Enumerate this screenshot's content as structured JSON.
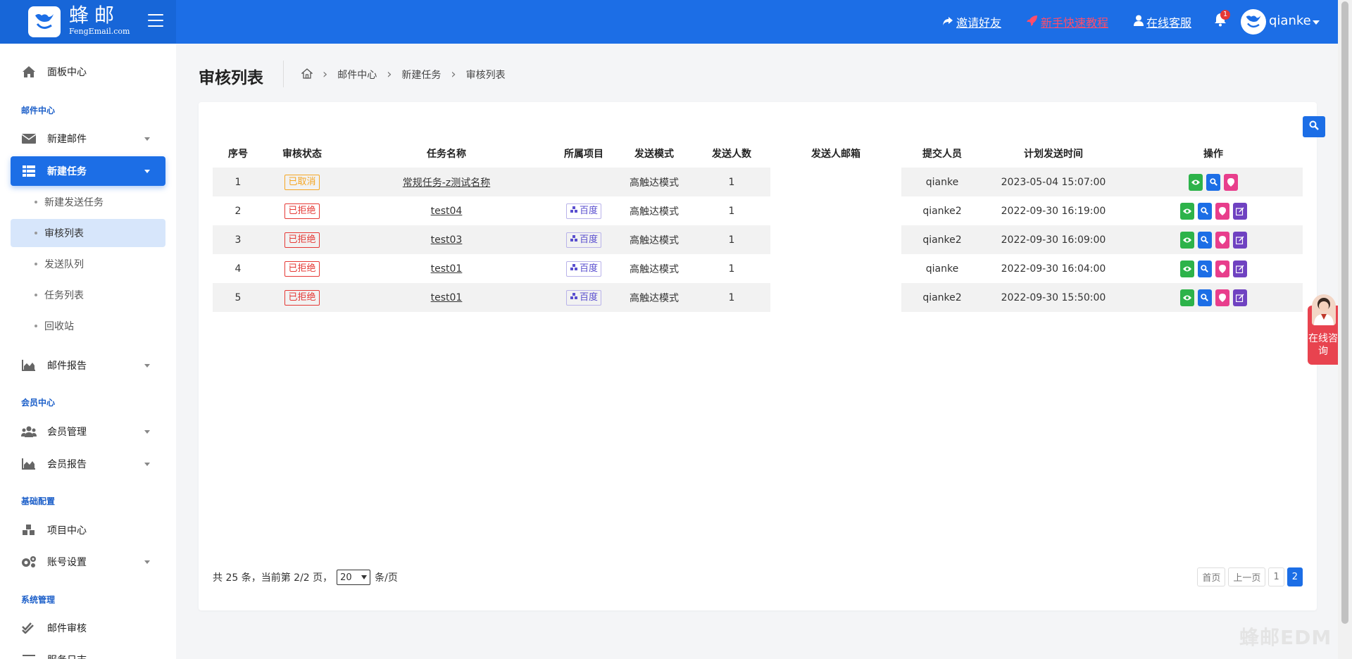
{
  "header": {
    "brand_name": "蜂邮",
    "brand_sub": "FengEmail.com",
    "links": {
      "invite": "邀请好友",
      "tutorial": "新手快速教程",
      "support": "在线客服"
    },
    "notification_count": "1",
    "username": "qianke",
    "colors": {
      "primary": "#1c6ee6",
      "tutorial": "#ff4d6b"
    }
  },
  "sidebar": {
    "dashboard": "面板中心",
    "section_mail": "邮件中心",
    "new_mail": "新建邮件",
    "new_task": "新建任务",
    "sub_items": [
      "新建发送任务",
      "审核列表",
      "发送队列",
      "任务列表",
      "回收站"
    ],
    "mail_report": "邮件报告",
    "section_member": "会员中心",
    "member_mgmt": "会员管理",
    "member_report": "会员报告",
    "section_config": "基础配置",
    "project_center": "项目中心",
    "account_settings": "账号设置",
    "section_system": "系统管理",
    "mail_review": "邮件审核",
    "more": "服务日志"
  },
  "page": {
    "title": "审核列表",
    "breadcrumb": [
      "邮件中心",
      "新建任务",
      "审核列表"
    ]
  },
  "table": {
    "columns": [
      "序号",
      "审核状态",
      "任务名称",
      "所属项目",
      "发送模式",
      "发送人数",
      "发送人邮箱",
      "提交人员",
      "计划发送时间",
      "操作"
    ],
    "rows": [
      {
        "no": "1",
        "status": "已取消",
        "status_type": "cancel",
        "name": "常规任务-z测试名称",
        "project": "",
        "mode": "高触达模式",
        "count": "1",
        "email": "",
        "submitter": "qianke",
        "time": "2023-05-04 15:07:00",
        "ops": [
          "eye",
          "mag",
          "pin"
        ]
      },
      {
        "no": "2",
        "status": "已拒绝",
        "status_type": "reject",
        "name": "test04",
        "project": "百度",
        "mode": "高触达模式",
        "count": "1",
        "email": "",
        "submitter": "qianke2",
        "time": "2022-09-30 16:19:00",
        "ops": [
          "eye",
          "mag",
          "pin",
          "edit"
        ]
      },
      {
        "no": "3",
        "status": "已拒绝",
        "status_type": "reject",
        "name": "test03",
        "project": "百度",
        "mode": "高触达模式",
        "count": "1",
        "email": "",
        "submitter": "qianke2",
        "time": "2022-09-30 16:09:00",
        "ops": [
          "eye",
          "mag",
          "pin",
          "edit"
        ]
      },
      {
        "no": "4",
        "status": "已拒绝",
        "status_type": "reject",
        "name": "test01",
        "project": "百度",
        "mode": "高触达模式",
        "count": "1",
        "email": "",
        "submitter": "qianke",
        "time": "2022-09-30 16:04:00",
        "ops": [
          "eye",
          "mag",
          "pin",
          "edit"
        ]
      },
      {
        "no": "5",
        "status": "已拒绝",
        "status_type": "reject",
        "name": "test01",
        "project": "百度",
        "mode": "高触达模式",
        "count": "1",
        "email": "",
        "submitter": "qianke2",
        "time": "2022-09-30 15:50:00",
        "ops": [
          "eye",
          "mag",
          "pin",
          "edit"
        ]
      }
    ]
  },
  "pagination": {
    "info_prefix": "共 25 条，当前第 2/2 页，",
    "page_size": "20",
    "info_suffix": "条/页",
    "first": "首页",
    "prev": "上一页",
    "pages": [
      "1",
      "2"
    ],
    "current": "2"
  },
  "float_consult": "在线咨询",
  "watermark": "蜂邮EDM"
}
